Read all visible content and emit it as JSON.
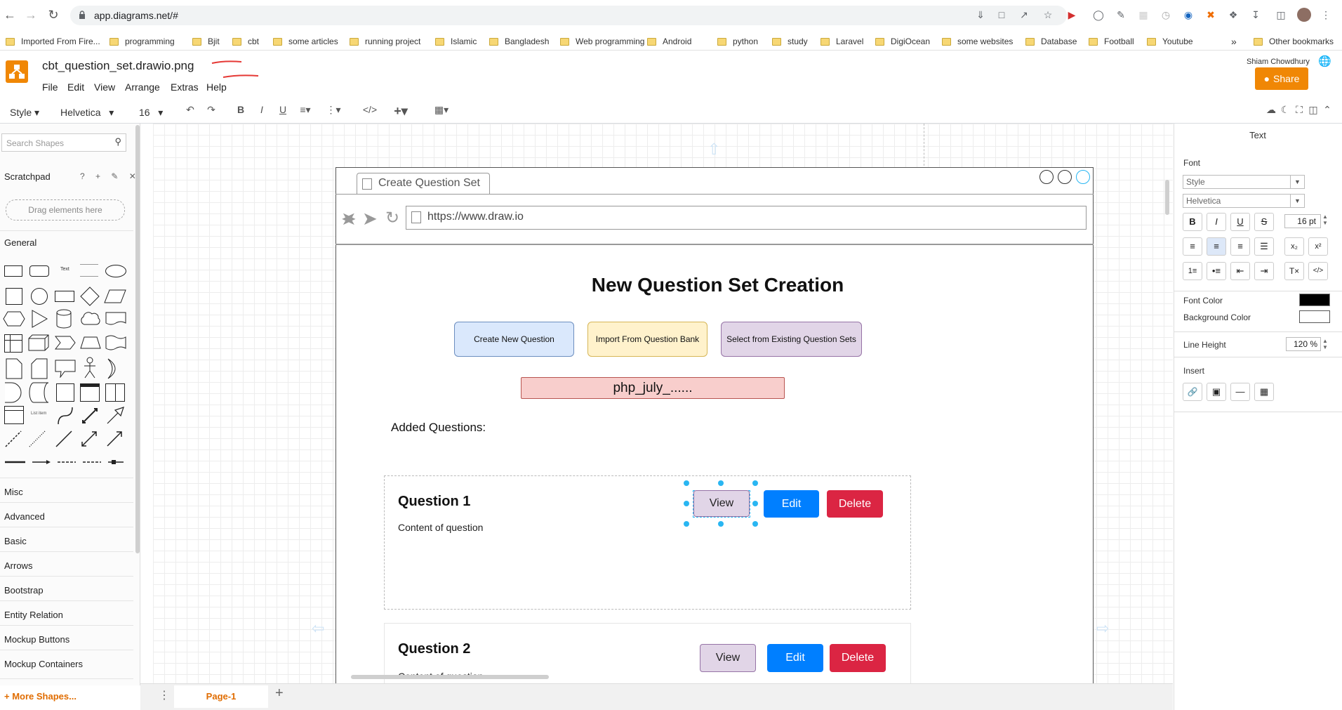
{
  "browser": {
    "url": "app.diagrams.net/#",
    "bookmarks": [
      "Imported From Fire...",
      "programming",
      "Bjit",
      "cbt",
      "some articles",
      "running project",
      "Islamic",
      "Bangladesh",
      "Web programming",
      "Android",
      "python",
      "study",
      "Laravel",
      "DigiOcean",
      "some websites",
      "Database",
      "Football",
      "Youtube"
    ],
    "other_bookmarks": "Other bookmarks",
    "overflow": "»"
  },
  "app": {
    "file_name": "cbt_question_set.drawio.png",
    "menus": [
      "File",
      "Edit",
      "View",
      "Arrange",
      "Extras",
      "Help"
    ],
    "user_name": "Shiam Chowdhury",
    "share_label": "Share"
  },
  "toolbar": {
    "style_label": "Style",
    "font_label": "Helvetica",
    "size_label": "16"
  },
  "left_panel": {
    "search_placeholder": "Search Shapes",
    "scratchpad_title": "Scratchpad",
    "scratchpad_icons": "? + ✎ ✕",
    "drag_hint": "Drag elements here",
    "general_title": "General",
    "categories": [
      "Misc",
      "Advanced",
      "Basic",
      "Arrows",
      "Bootstrap",
      "Entity Relation",
      "Mockup Buttons",
      "Mockup Containers"
    ],
    "more_shapes": "+ More Shapes..."
  },
  "mockup": {
    "tab_title": "Create Question Set",
    "url": "https://www.draw.io",
    "page_title": "New Question Set Creation",
    "options": [
      "Create New Question",
      "Import From Question Bank",
      "Select from Existing Question Sets"
    ],
    "option_colors": [
      "#dae8fc",
      "#fff2cc",
      "#e1d5e7"
    ],
    "option_borders": [
      "#6c8ebf",
      "#d6b656",
      "#9673a6"
    ],
    "set_name": "php_july_......",
    "added_label": "Added Questions:",
    "questions": [
      {
        "title": "Question 1",
        "content": "Content of question",
        "view": "View",
        "edit": "Edit",
        "delete": "Delete"
      },
      {
        "title": "Question 2",
        "content": "Content of question",
        "view": "View",
        "edit": "Edit",
        "delete": "Delete"
      }
    ]
  },
  "right_panel": {
    "tab": "Text",
    "font_heading": "Font",
    "style_select": "Style",
    "font_select": "Helvetica",
    "font_size": "16 pt",
    "font_color_label": "Font Color",
    "bg_color_label": "Background Color",
    "line_height_label": "Line Height",
    "line_height_value": "120 %",
    "insert_label": "Insert"
  },
  "bottom": {
    "page_tab": "Page-1"
  }
}
